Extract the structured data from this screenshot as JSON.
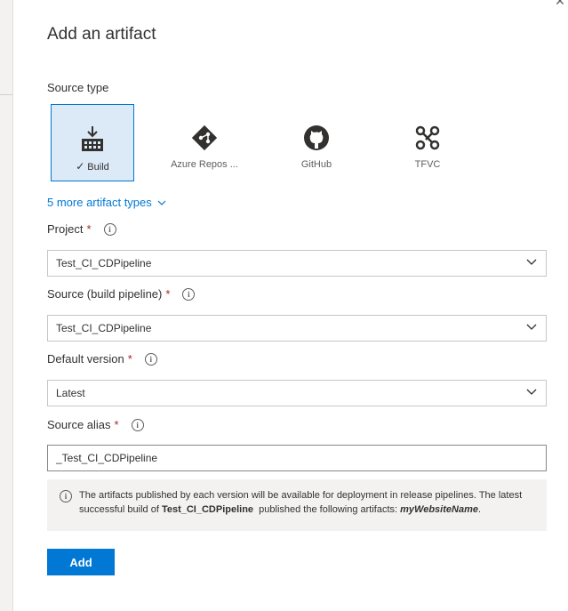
{
  "dialog": {
    "title": "Add an artifact",
    "close_glyph": "✕"
  },
  "source_type": {
    "label": "Source type",
    "options": [
      {
        "label": "Build",
        "icon": "build-icon",
        "selected": true
      },
      {
        "label": "Azure Repos ...",
        "icon": "azure-repos-icon",
        "selected": false
      },
      {
        "label": "GitHub",
        "icon": "github-icon",
        "selected": false
      },
      {
        "label": "TFVC",
        "icon": "tfvc-icon",
        "selected": false
      }
    ],
    "check_glyph": "✓",
    "more_link": "5 more artifact types"
  },
  "fields": {
    "project": {
      "label": "Project",
      "required_mark": "*",
      "value": "Test_CI_CDPipeline"
    },
    "source": {
      "label": "Source (build pipeline)",
      "required_mark": "*",
      "value": "Test_CI_CDPipeline"
    },
    "default_version": {
      "label": "Default version",
      "required_mark": "*",
      "value": "Latest"
    },
    "source_alias": {
      "label": "Source alias",
      "required_mark": "*",
      "value": "_Test_CI_CDPipeline"
    }
  },
  "info": {
    "icon_glyph": "i",
    "text_before": "The artifacts published by each version will be available for deployment in release pipelines. The latest successful build of ",
    "pipeline_name": "Test_CI_CDPipeline",
    "text_middle": "  published the following artifacts: ",
    "artifact_name": "myWebsiteName",
    "text_after": "."
  },
  "actions": {
    "add_label": "Add"
  },
  "colors": {
    "accent": "#0078d4",
    "selected_bg": "#dce9f7",
    "required": "#a4262c",
    "info_bg": "#f3f2f1"
  }
}
